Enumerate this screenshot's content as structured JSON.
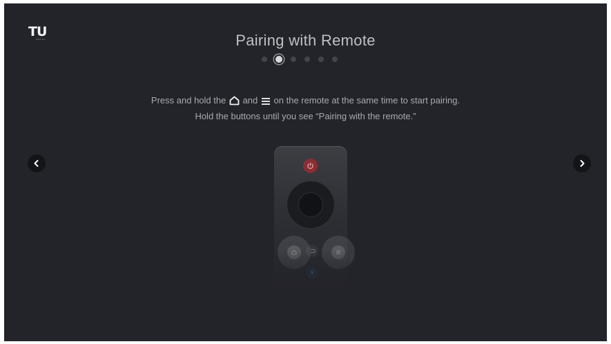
{
  "brand": {
    "logo_text": "TU",
    "logo_subtext": "SERIES"
  },
  "title": "Pairing with Remote",
  "pagination": {
    "total_steps": 6,
    "current_step": 2
  },
  "instructions": {
    "line1_prefix": "Press and hold the",
    "line1_and": "and",
    "line1_suffix": "on the remote at the same time to start pairing.",
    "line2": "Hold the buttons until you see “Pairing with the remote.”",
    "icons": [
      "home-icon",
      "menu-icon"
    ]
  },
  "navigation": {
    "prev_icon": "chevron-left-icon",
    "next_icon": "chevron-right-icon"
  },
  "remote": {
    "highlighted_buttons": [
      "home-button",
      "menu-button"
    ],
    "icons": [
      "power-icon",
      "back-icon",
      "mic-icon"
    ]
  },
  "colors": {
    "background": "#23242a",
    "power_button": "#8a2e33",
    "active_dot": "#d8d9dc",
    "inactive_dot": "#44454b"
  }
}
